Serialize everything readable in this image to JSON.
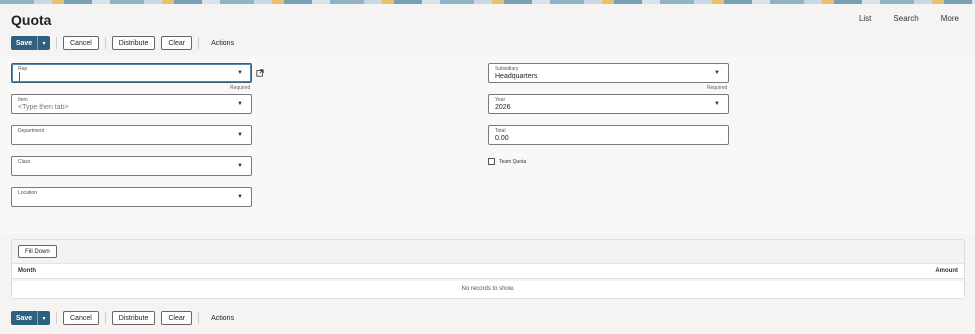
{
  "header": {
    "title": "Quota",
    "links": [
      "List",
      "Search",
      "More"
    ]
  },
  "toolbar": {
    "save_label": "Save",
    "cancel_label": "Cancel",
    "distribute_label": "Distribute",
    "clear_label": "Clear",
    "actions_label": "Actions"
  },
  "form": {
    "rep": {
      "label": "Rep",
      "value": "",
      "hint": "Required"
    },
    "item": {
      "label": "Item",
      "placeholder": "<Type then tab>"
    },
    "department": {
      "label": "Department",
      "value": ""
    },
    "class": {
      "label": "Class",
      "value": ""
    },
    "location": {
      "label": "Location",
      "value": ""
    },
    "subsidiary": {
      "label": "Subsidiary",
      "value": "Headquarters",
      "hint": "Required"
    },
    "year": {
      "label": "Year",
      "value": "2026"
    },
    "total": {
      "label": "Total",
      "value": "0.00"
    },
    "team_quota": {
      "label": "Team Quota",
      "checked": false
    }
  },
  "sublist": {
    "fill_down_label": "Fill Down",
    "columns": [
      "Month",
      "Amount"
    ],
    "empty_message": "No records to show."
  },
  "colors": {
    "primary": "#2e6080",
    "background": "#f5f4f2"
  }
}
